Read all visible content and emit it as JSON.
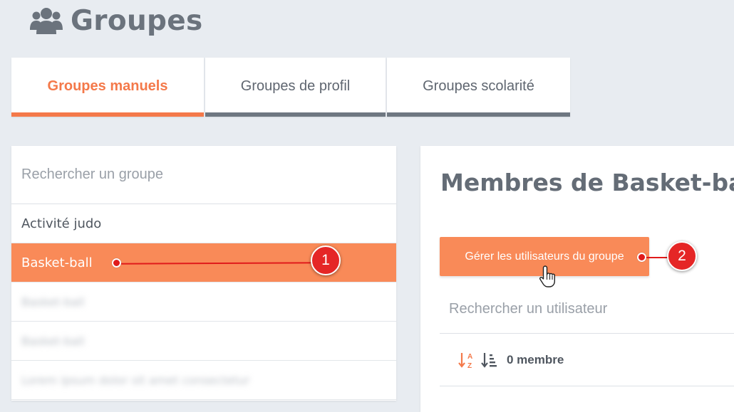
{
  "page": {
    "title": "Groupes",
    "icon": "users-icon"
  },
  "tabs": [
    {
      "label": "Groupes manuels",
      "active": true
    },
    {
      "label": "Groupes de profil",
      "active": false
    },
    {
      "label": "Groupes scolarité",
      "active": false
    }
  ],
  "groups": {
    "search_placeholder": "Rechercher un groupe",
    "items": [
      {
        "label": "Activité judo",
        "selected": false
      },
      {
        "label": "Basket-ball",
        "selected": true
      },
      {
        "label": "Basket-ball",
        "blurred": true
      },
      {
        "label": "Basket-ball",
        "blurred": true
      },
      {
        "label": "Lorem ipsum dolor sit amet consectetur",
        "blurred": true
      }
    ]
  },
  "members": {
    "title": "Membres de Basket-ball",
    "manage_button": "Gérer les utilisateurs du groupe",
    "search_placeholder": "Rechercher un utilisateur",
    "count_label": "0 membre"
  },
  "callouts": [
    "1",
    "2"
  ],
  "colors": {
    "accent": "#f98a58",
    "accent_text": "#f4794a",
    "callout": "#e52626",
    "background": "#e8ecf1"
  }
}
